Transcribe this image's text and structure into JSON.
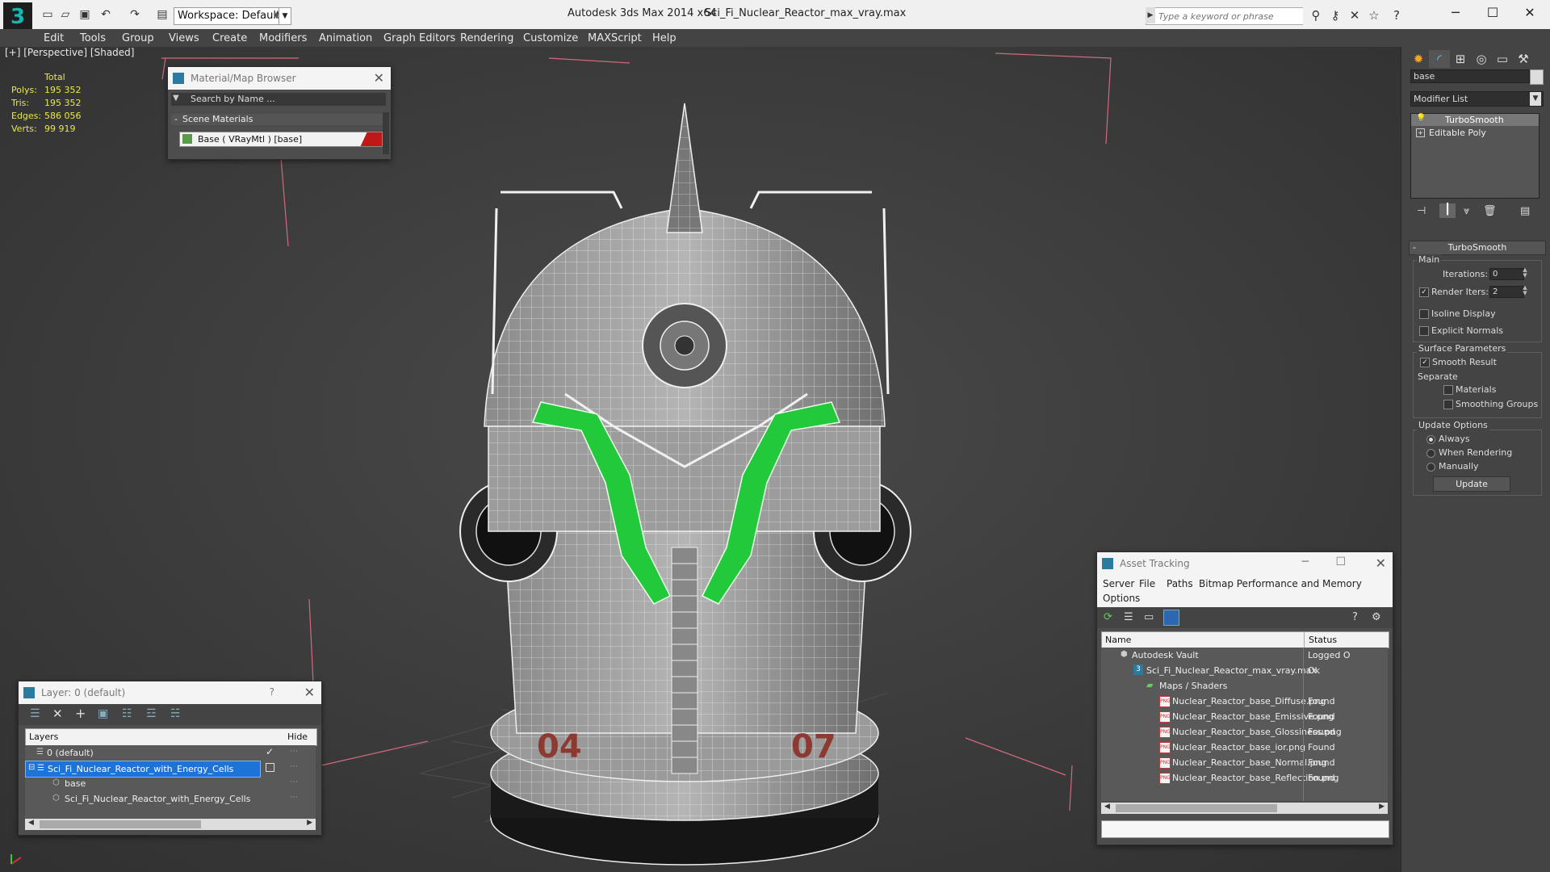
{
  "titlebar": {
    "workspace": "Workspace: Default",
    "app_title": "Autodesk 3ds Max  2014 x64",
    "file_title": "Sci_Fi_Nuclear_Reactor_max_vray.max",
    "search_placeholder": "Type a keyword or phrase"
  },
  "menu": [
    "Edit",
    "Tools",
    "Group",
    "Views",
    "Create",
    "Modifiers",
    "Animation",
    "Graph Editors",
    "Rendering",
    "Customize",
    "MAXScript",
    "Help"
  ],
  "viewport": {
    "label": "[+] [Perspective] [Shaded]",
    "stats": {
      "header": "Total",
      "rows": [
        {
          "label": "Polys:",
          "value": "195 352"
        },
        {
          "label": "Tris:",
          "value": "195 352"
        },
        {
          "label": "Edges:",
          "value": "586 056"
        },
        {
          "label": "Verts:",
          "value": "99 919"
        }
      ]
    },
    "label_04": "04",
    "label_07": "07"
  },
  "material_browser": {
    "title": "Material/Map Browser",
    "search_placeholder": "Search by Name ...",
    "section": "Scene Materials",
    "item": "Base  ( VRayMtl )  [base]"
  },
  "layer_panel": {
    "title": "Layer: 0 (default)",
    "help": "?",
    "col_layers": "Layers",
    "col_hide": "Hide",
    "rows": [
      {
        "name": "0 (default)"
      },
      {
        "name": "Sci_Fi_Nuclear_Reactor_with_Energy_Cells"
      },
      {
        "name": "base"
      },
      {
        "name": "Sci_Fi_Nuclear_Reactor_with_Energy_Cells"
      }
    ]
  },
  "asset_tracking": {
    "title": "Asset Tracking",
    "menu": [
      "Server",
      "File",
      "Paths",
      "Bitmap Performance and Memory"
    ],
    "menu2": "Options",
    "col_name": "Name",
    "col_status": "Status",
    "rows": [
      {
        "name": "Autodesk Vault",
        "status": "Logged O"
      },
      {
        "name": "Sci_Fi_Nuclear_Reactor_max_vray.max",
        "status": "Ok"
      },
      {
        "name": "Maps / Shaders",
        "status": ""
      },
      {
        "name": "Nuclear_Reactor_base_Diffuse.png",
        "status": "Found"
      },
      {
        "name": "Nuclear_Reactor_base_Emissive.png",
        "status": "Found"
      },
      {
        "name": "Nuclear_Reactor_base_Glossiness.png",
        "status": "Found"
      },
      {
        "name": "Nuclear_Reactor_base_ior.png",
        "status": "Found"
      },
      {
        "name": "Nuclear_Reactor_base_Normal.png",
        "status": "Found"
      },
      {
        "name": "Nuclear_Reactor_base_Reflection.png",
        "status": "Found"
      }
    ]
  },
  "command_panel": {
    "object_name": "base",
    "modifier_list": "Modifier List",
    "stack": [
      "TurboSmooth",
      "Editable Poly"
    ],
    "rollout_title": "TurboSmooth",
    "main_label": "Main",
    "iterations_label": "Iterations:",
    "iterations_value": "0",
    "render_iters_label": "Render Iters:",
    "render_iters_value": "2",
    "isoline": "Isoline Display",
    "explicit_normals": "Explicit Normals",
    "surface_params": "Surface Parameters",
    "smooth_result": "Smooth Result",
    "separate": "Separate",
    "materials": "Materials",
    "smoothing_groups": "Smoothing Groups",
    "update_options": "Update Options",
    "always": "Always",
    "when_rendering": "When Rendering",
    "manually": "Manually",
    "update_button": "Update"
  },
  "colors": {
    "accent_green": "#22c93a",
    "selection_blue": "#1e73d6",
    "stats_yellow": "#e8e84a"
  }
}
